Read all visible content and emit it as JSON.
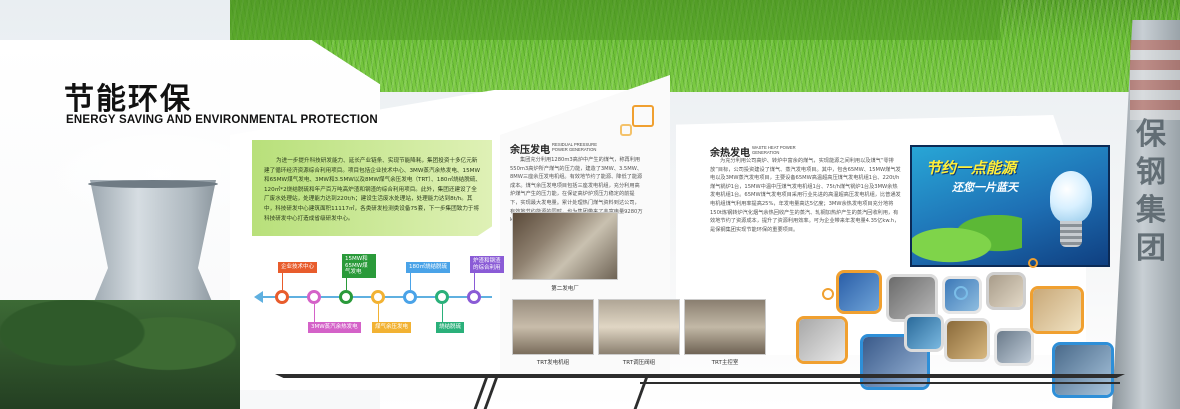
{
  "header": {
    "title_cn": "节能环保",
    "title_en": "ENERGY SAVING AND ENVIRONMENTAL PROTECTION"
  },
  "intro": {
    "text": "为进一步提升科技研发能力、延长产业链条、实现节能降耗，集团投资十多亿元新建了循环经济资源综合利用项目。项目包括企业技术中心、3MW蒸汽余热发电、15MW和65MW煤气发电、3MW和3.5MW以及8MW煤气余压发电（TRT）、180㎡烧结脱硫、120㎡*2烧结脱硫和年产百万吨高炉渣和钢渣的综合利用项目。此外，集团还建设了全厂废水处理站，处理能力达到220t/h；建设生活废水处理站，处理能力达到8t/h。其中，科技研发中心建筑面积11117㎡，各类研发检测类设备75套，下一步集团致力于将科技研发中心打造成省级研发中心。"
  },
  "timeline": {
    "items": [
      {
        "label": "企业技术中心",
        "color": "#e85c2c"
      },
      {
        "label": "3MW蒸汽余热发电",
        "color": "#d462c8"
      },
      {
        "label": "15MW和65MW煤气发电",
        "color": "#2a9a3a"
      },
      {
        "label": "煤气余压发电",
        "color": "#f2b233"
      },
      {
        "label": "180㎡烧结脱硫",
        "color": "#4aa3e8"
      },
      {
        "label": "烧结脱硫",
        "color": "#2ab07a"
      },
      {
        "label": "炉渣和钢渣的综合利用",
        "color": "#8a5bd6"
      }
    ],
    "line_color": "#5fb0e0"
  },
  "residual_pressure": {
    "title": "余压发电",
    "en": "RESIDUAL PRESSURE POWER GENERATION",
    "text": "集团充分利用1280m3高炉中产生的煤气，称再利用550m3高炉所产煤气的压力能，建造了3MW、3.5MW、8MW三座余压发电机组。有效地节约了能源、降低了能源成本。煤气余压发电项目包括三座发电机组，充分利用高炉煤气产生的压力能，在保证高炉炉顶压力稳定的前提下，实现最大发电量。累计处理热门煤气资料到达公司，有效地节约能源的同时，也为集团带来了丰富电量9280万kw.h。",
    "photo_main_caption": "第二发电厂",
    "photos": [
      {
        "caption": "TRT发电机组"
      },
      {
        "caption": "TRT调压阀组"
      },
      {
        "caption": "TRT主控室"
      }
    ]
  },
  "waste_heat": {
    "title": "余热发电",
    "en": "WASTE HEAT POWER GENERATION",
    "text": "为充分利用公司高炉、转炉中富余的煤气，实现能源之间利用以及煤气“零排放”目标，公司投资建设了煤气、蒸汽发电项目。其中，包含65MW、15MW煤气发电以及3MW蒸汽发电项目，主要设备65MW高温超高压煤气发电机组1台、220t/h煤气锅炉1台，15MW中温中压煤气发电机组1台、75t/h煤气锅炉1台及3MW余热发电机组1台。65MW煤气发电项目采用行业先进的高温超高压发电机组，比普通发电机组煤气利用率提高25%，年发电量高达5亿度；3MW余热发电项目充分地将150t炼钢转炉汽化烟气余热回收产生的蒸汽、轧钢加热炉产生的蒸汽回收利用，有效地节约了资源成本，提升了资源利用效率。可为企业带来年发电量4.35亿kw.h，是保钢集团实现节能环保的重要项目。"
  },
  "billboard": {
    "line1": "节约一点能源",
    "line2": "还您一片蓝天"
  },
  "chimney": {
    "chars": [
      "保",
      "钢",
      "集",
      "团"
    ]
  }
}
